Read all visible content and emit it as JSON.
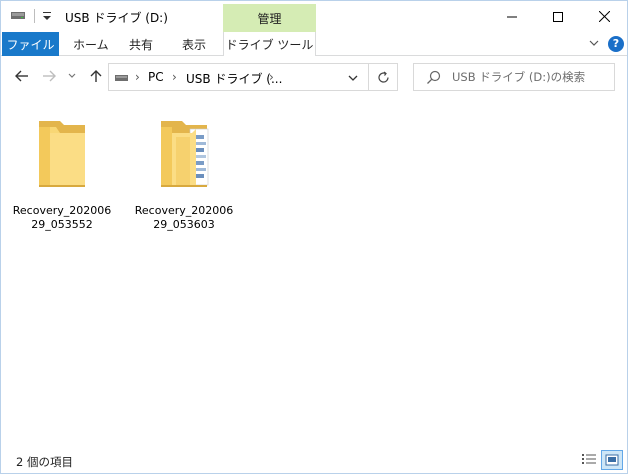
{
  "titlebar": {
    "title": "USB ドライブ (D:)",
    "context_tab": "管理",
    "controls": {
      "minimize": "minimize-icon",
      "maximize": "maximize-icon",
      "close": "close-icon"
    }
  },
  "ribbon": {
    "file_tab": "ファイル",
    "tabs": [
      "ホーム",
      "共有",
      "表示"
    ],
    "context_tab": "ドライブ ツール",
    "help_label": "?",
    "accent_color": "#1979ca",
    "context_color": "#d5ecb4"
  },
  "navigation": {
    "breadcrumb": [
      "PC",
      "USB ドライブ (..."
    ],
    "search_placeholder": "USB ドライブ (D:)の検索"
  },
  "items": [
    {
      "name": "Recovery_20200629_053552",
      "label": "Recovery_202006\n29_053552",
      "icon": "empty-folder-icon"
    },
    {
      "name": "Recovery_20200629_053603",
      "label": "Recovery_202006\n29_053603",
      "icon": "folder-with-files-icon"
    }
  ],
  "status": {
    "item_count": "2 個の項目"
  }
}
